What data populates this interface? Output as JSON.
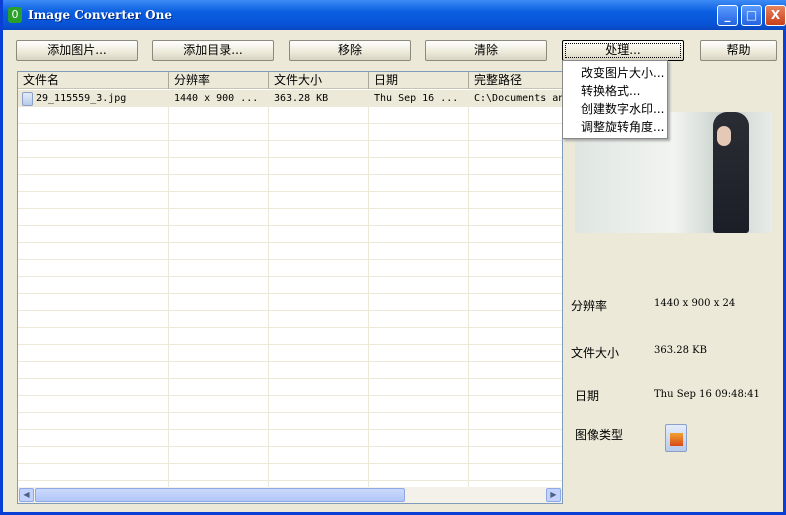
{
  "window": {
    "title": "Image Converter One",
    "minimize": "_",
    "maximize": "□",
    "close": "X"
  },
  "toolbar": {
    "add_image": "添加图片...",
    "add_dir": "添加目录...",
    "remove": "移除",
    "clear": "清除",
    "process": "处理...",
    "help": "帮助"
  },
  "table": {
    "columns": [
      "文件名",
      "分辨率",
      "文件大小",
      "日期",
      "完整路径"
    ],
    "rows": [
      [
        "29_115559_3.jpg",
        "1440 x 900 ...",
        "363.28 KB",
        "Thu Sep 16 ...",
        "C:\\Documents and"
      ]
    ]
  },
  "menu": {
    "items": [
      "改变图片大小...",
      "转换格式...",
      "创建数字水印...",
      "调整旋转角度..."
    ]
  },
  "info": {
    "resolution_label": "分辨率",
    "resolution": "1440 x 900 x 24",
    "size_label": "文件大小",
    "size": "363.28 KB",
    "date_label": "日期",
    "date": "Thu Sep 16 09:48:41",
    "type_label": "图像类型"
  }
}
